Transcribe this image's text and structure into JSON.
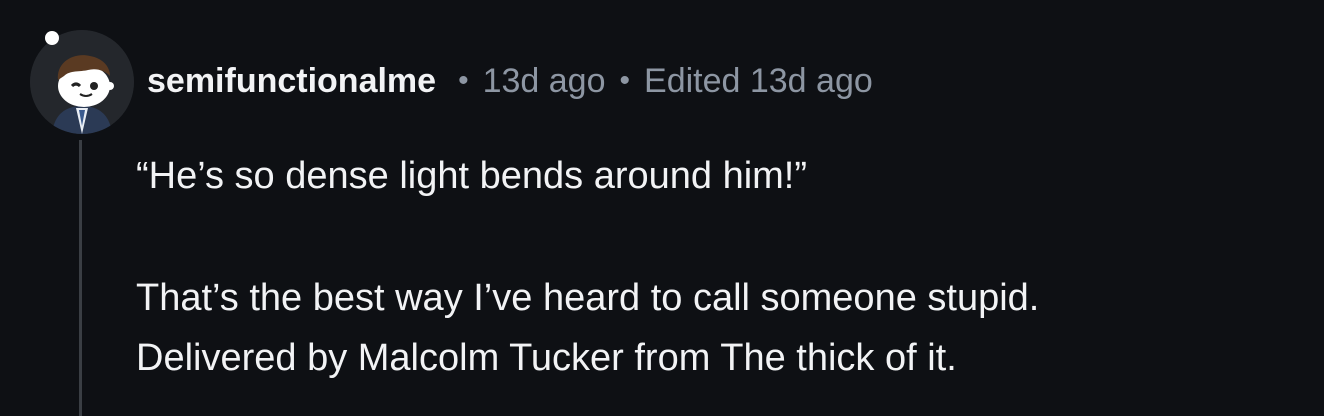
{
  "comment": {
    "username": "semifunctionalme",
    "separator": "•",
    "posted_time": "13d ago",
    "edited_time": "Edited 13d ago",
    "avatar_icon": "snoo-avatar-icon",
    "paragraphs": [
      "“He’s so dense light bends around him!”",
      "That’s the best way I’ve heard to call someone stupid.",
      "Delivered by Malcolm Tucker from The thick of it."
    ]
  },
  "colors": {
    "background": "#0e1014",
    "text": "#f2f3f5",
    "meta": "#8d96a3",
    "thread_line": "#3a3e44"
  }
}
